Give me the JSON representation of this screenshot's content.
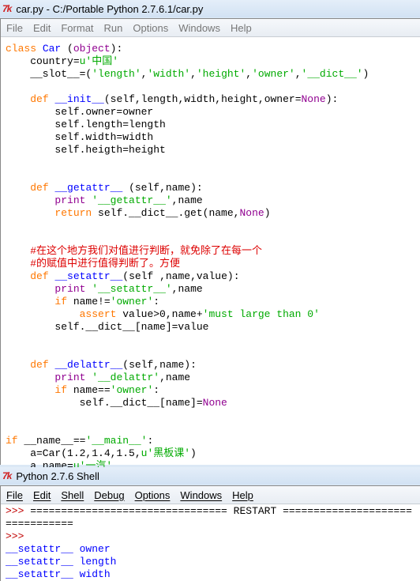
{
  "editor": {
    "title": "car.py - C:/Portable Python 2.7.6.1/car.py",
    "logo": "7k",
    "menu": [
      "File",
      "Edit",
      "Format",
      "Run",
      "Options",
      "Windows",
      "Help"
    ],
    "lines": [
      [
        [
          "class",
          "k"
        ],
        [
          " ",
          ""
        ],
        [
          "Car",
          "d"
        ],
        [
          " (",
          ""
        ],
        [
          "object",
          "b"
        ],
        [
          "):",
          ""
        ]
      ],
      [
        [
          "    country=",
          ""
        ],
        [
          "u'中国'",
          "s"
        ]
      ],
      [
        [
          "    __slot__=(",
          ""
        ],
        [
          "'length'",
          "s"
        ],
        [
          ",",
          ""
        ],
        [
          "'width'",
          "s"
        ],
        [
          ",",
          ""
        ],
        [
          "'height'",
          "s"
        ],
        [
          ",",
          ""
        ],
        [
          "'owner'",
          "s"
        ],
        [
          ",",
          ""
        ],
        [
          "'__dict__'",
          "s"
        ],
        [
          ")",
          ""
        ]
      ],
      [],
      [
        [
          "    ",
          ""
        ],
        [
          "def",
          "k"
        ],
        [
          " ",
          ""
        ],
        [
          "__init__",
          "d"
        ],
        [
          "(self,length,width,height,owner=",
          ""
        ],
        [
          "None",
          "b"
        ],
        [
          "):",
          ""
        ]
      ],
      [
        [
          "        self.owner=owner",
          ""
        ]
      ],
      [
        [
          "        self.length=length",
          ""
        ]
      ],
      [
        [
          "        self.width=width",
          ""
        ]
      ],
      [
        [
          "        self.heigth=height",
          ""
        ]
      ],
      [],
      [],
      [
        [
          "    ",
          ""
        ],
        [
          "def",
          "k"
        ],
        [
          " ",
          ""
        ],
        [
          "__getattr__",
          "d"
        ],
        [
          " (self,name):",
          ""
        ]
      ],
      [
        [
          "        ",
          ""
        ],
        [
          "print",
          "b"
        ],
        [
          " ",
          ""
        ],
        [
          "'__getattr__'",
          "s"
        ],
        [
          ",name",
          ""
        ]
      ],
      [
        [
          "        ",
          ""
        ],
        [
          "return",
          "k"
        ],
        [
          " self.__dict__.get(name,",
          ""
        ],
        [
          "None",
          "b"
        ],
        [
          ")",
          ""
        ]
      ],
      [],
      [],
      [
        [
          "    ",
          ""
        ],
        [
          "#在这个地方我们对值进行判断，就免除了在每一个",
          "c"
        ]
      ],
      [
        [
          "    ",
          ""
        ],
        [
          "#的赋值中进行值得判断了。方便",
          "c"
        ]
      ],
      [
        [
          "    ",
          ""
        ],
        [
          "def",
          "k"
        ],
        [
          " ",
          ""
        ],
        [
          "__setattr__",
          "d"
        ],
        [
          "(self ,name,value):",
          ""
        ]
      ],
      [
        [
          "        ",
          ""
        ],
        [
          "print",
          "b"
        ],
        [
          " ",
          ""
        ],
        [
          "'__setattr__'",
          "s"
        ],
        [
          ",name",
          ""
        ]
      ],
      [
        [
          "        ",
          ""
        ],
        [
          "if",
          "k"
        ],
        [
          " name!=",
          ""
        ],
        [
          "'owner'",
          "s"
        ],
        [
          ":",
          ""
        ]
      ],
      [
        [
          "            ",
          ""
        ],
        [
          "assert",
          "k"
        ],
        [
          " value>0,name+",
          ""
        ],
        [
          "'must large than 0'",
          "s"
        ]
      ],
      [
        [
          "        self.__dict__[name]=value",
          ""
        ]
      ],
      [],
      [],
      [
        [
          "    ",
          ""
        ],
        [
          "def",
          "k"
        ],
        [
          " ",
          ""
        ],
        [
          "__delattr__",
          "d"
        ],
        [
          "(self,name):",
          ""
        ]
      ],
      [
        [
          "        ",
          ""
        ],
        [
          "print",
          "b"
        ],
        [
          " ",
          ""
        ],
        [
          "'__delattr'",
          "s"
        ],
        [
          ",name",
          ""
        ]
      ],
      [
        [
          "        ",
          ""
        ],
        [
          "if",
          "k"
        ],
        [
          " name==",
          ""
        ],
        [
          "'owner'",
          "s"
        ],
        [
          ":",
          ""
        ]
      ],
      [
        [
          "            self.__dict__[name]=",
          ""
        ],
        [
          "None",
          "b"
        ]
      ],
      [],
      [],
      [
        [
          "if",
          "k"
        ],
        [
          " __name__==",
          ""
        ],
        [
          "'__main__'",
          "s"
        ],
        [
          ":",
          ""
        ]
      ],
      [
        [
          "    a=Car(1.2,1.4,1.5,",
          ""
        ],
        [
          "u'黑板课'",
          "s"
        ],
        [
          ")",
          ""
        ]
      ],
      [
        [
          "    a.name=",
          ""
        ],
        [
          "u'一汽'",
          "s"
        ]
      ]
    ]
  },
  "shell": {
    "title": "Python 2.7.6 Shell",
    "logo": "7k",
    "menu": [
      "File",
      "Edit",
      "Shell",
      "Debug",
      "Options",
      "Windows",
      "Help"
    ],
    "lines": [
      [
        [
          ">>> ",
          "p"
        ],
        [
          "================================ RESTART ================================",
          ""
        ]
      ],
      [
        [
          ">>> ",
          "p"
        ]
      ],
      [
        [
          "__setattr__ owner",
          "o"
        ]
      ],
      [
        [
          "__setattr__ length",
          "o"
        ]
      ],
      [
        [
          "__setattr__ width",
          "o"
        ]
      ]
    ]
  },
  "colors": {
    "keyword": "#ff7700",
    "definition": "#0000ff",
    "string": "#00aa00",
    "builtin": "#900090",
    "comment": "#dd0000",
    "prompt": "#c00000",
    "stdout": "#0000ff"
  }
}
